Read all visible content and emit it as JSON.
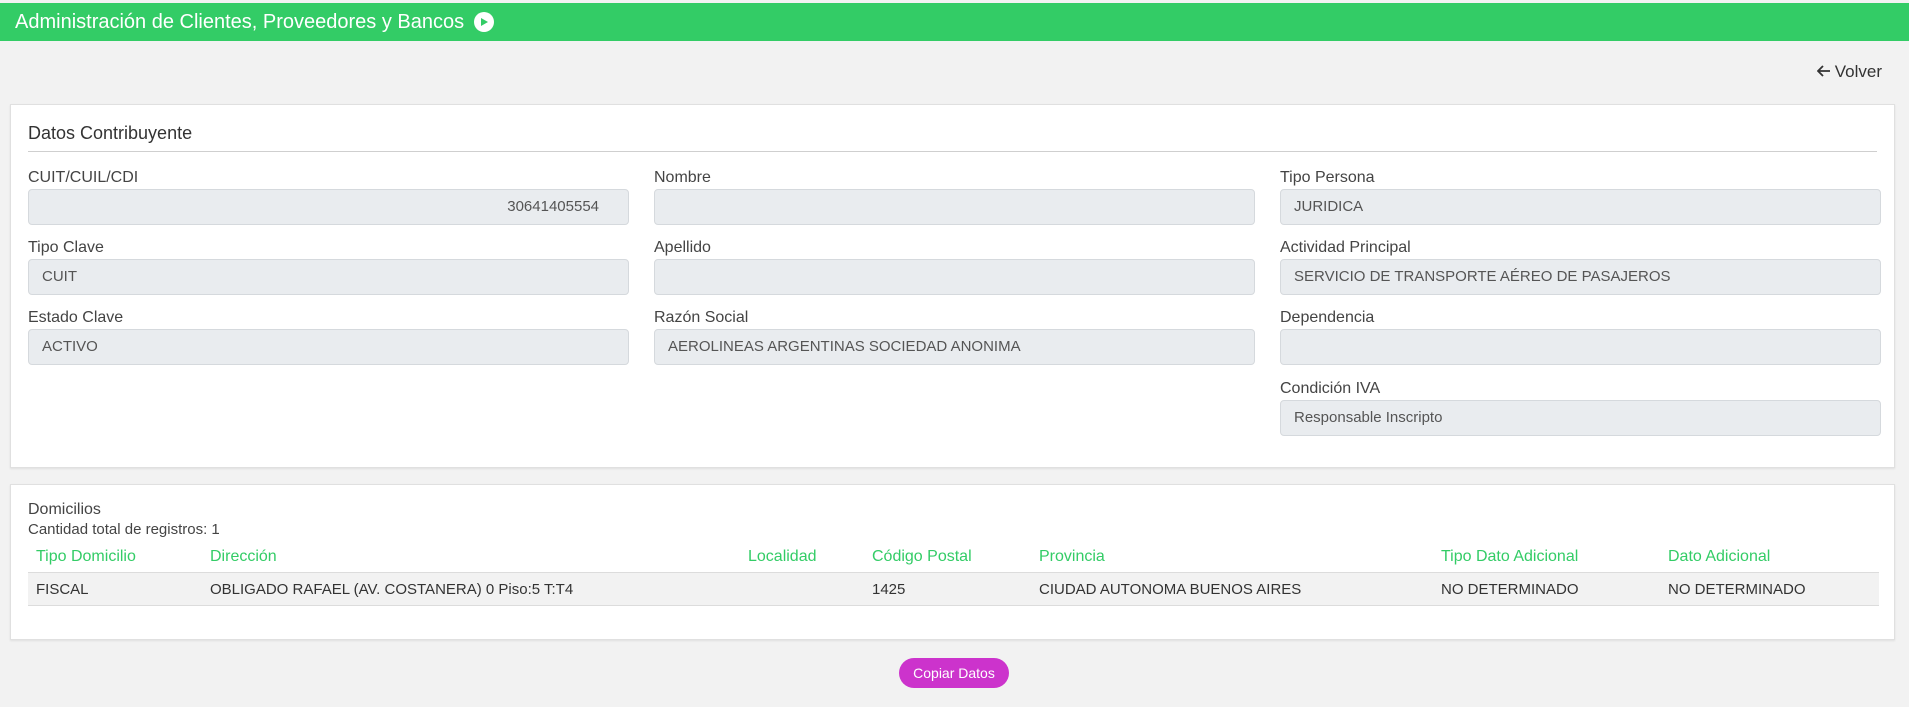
{
  "header": {
    "title": "Administración de Clientes, Proveedores y Bancos",
    "accent": "#33cc66"
  },
  "nav": {
    "back_label": "Volver"
  },
  "contribuyente": {
    "section_title": "Datos Contribuyente",
    "cuit": {
      "label": "CUIT/CUIL/CDI",
      "value": "30641405554"
    },
    "tipo_clave": {
      "label": "Tipo Clave",
      "value": "CUIT"
    },
    "estado_clave": {
      "label": "Estado Clave",
      "value": "ACTIVO"
    },
    "nombre": {
      "label": "Nombre",
      "value": ""
    },
    "apellido": {
      "label": "Apellido",
      "value": ""
    },
    "razon_social": {
      "label": "Razón Social",
      "value": "AEROLINEAS ARGENTINAS SOCIEDAD ANONIMA"
    },
    "tipo_persona": {
      "label": "Tipo Persona",
      "value": "JURIDICA"
    },
    "actividad": {
      "label": "Actividad Principal",
      "value": "SERVICIO DE TRANSPORTE AÉREO DE PASAJEROS"
    },
    "dependencia": {
      "label": "Dependencia",
      "value": ""
    },
    "condicion_iva": {
      "label": "Condición IVA",
      "value": "Responsable Inscripto"
    }
  },
  "domicilios": {
    "title": "Domicilios",
    "count_text": "Cantidad total de registros: 1",
    "columns": [
      "Tipo Domicilio",
      "Dirección",
      "Localidad",
      "Código Postal",
      "Provincia",
      "Tipo Dato Adicional",
      "Dato Adicional"
    ],
    "rows": [
      [
        "FISCAL",
        "OBLIGADO RAFAEL (AV. COSTANERA) 0 Piso:5 T:T4",
        "",
        "1425",
        "CIUDAD AUTONOMA BUENOS AIRES",
        "NO DETERMINADO",
        "NO DETERMINADO"
      ]
    ]
  },
  "actions": {
    "copy_label": "Copiar Datos",
    "copy_color": "#cc33cc"
  }
}
